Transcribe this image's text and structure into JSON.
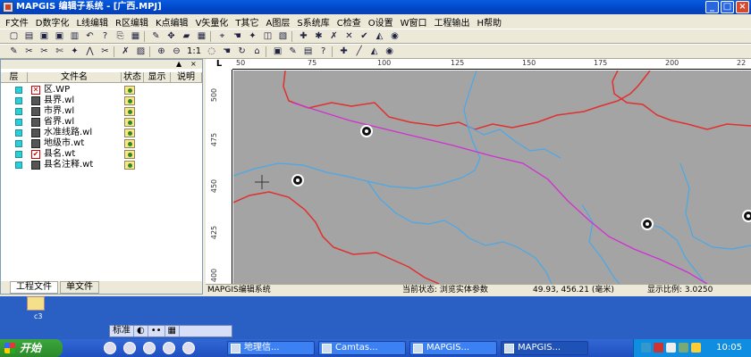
{
  "window": {
    "title": "MAPGIS 编辑子系统 - [广西.MPJ]",
    "controls": [
      "_",
      "□",
      "×"
    ]
  },
  "menu": [
    "F文件",
    "D数字化",
    "L线编辑",
    "R区编辑",
    "K点编辑",
    "V矢量化",
    "T其它",
    "A图层",
    "S系统库",
    "C检查",
    "O设置",
    "W窗口",
    "工程输出",
    "H帮助"
  ],
  "toolbar": {
    "zoom_label": "1:1"
  },
  "project_panel": {
    "controls": [
      "▲",
      "×"
    ],
    "columns": [
      "层",
      "文件名",
      "状态",
      "显示",
      "说明"
    ],
    "files": [
      {
        "name": "区.WP",
        "icon": "region-file-icon"
      },
      {
        "name": "县界.wl",
        "icon": "line-file-icon"
      },
      {
        "name": "市界.wl",
        "icon": "line-file-icon"
      },
      {
        "name": "省界.wl",
        "icon": "line-file-icon"
      },
      {
        "name": "水准线路.wl",
        "icon": "line-file-icon"
      },
      {
        "name": "地级市.wt",
        "icon": "point-file-icon"
      },
      {
        "name": "县名.wt",
        "icon": "point-file-icon"
      },
      {
        "name": "县名注释.wt",
        "icon": "point-file-icon"
      }
    ],
    "tabs": [
      "工程文件",
      "单文件"
    ]
  },
  "map": {
    "ruler_corner": "L",
    "ruler_top_ticks": [
      "50",
      "75",
      "100",
      "125",
      "150",
      "175",
      "200",
      "22"
    ],
    "ruler_left_ticks": [
      "500",
      "475",
      "450",
      "425",
      "400"
    ],
    "colors": {
      "background": "#a4a4a4",
      "red_boundary": "#e03030",
      "blue_river": "#4aa8e8",
      "magenta_route": "#d030d0"
    }
  },
  "status": {
    "app_name": "MAPGIS编辑系统",
    "state_label": "当前状态: 浏览实体参数",
    "coords": "49.93, 456.21 (毫米)",
    "scale": "显示比例: 3.0250"
  },
  "desktop": {
    "icon_label": "c3"
  },
  "language_bar": {
    "items": [
      "标准",
      "◐",
      "••",
      "▦"
    ]
  },
  "taskbar": {
    "start_label": "开始",
    "tasks": [
      "地理信...",
      "Camtas...",
      "MAPGIS...",
      "MAPGIS..."
    ],
    "clock": "10:05"
  }
}
